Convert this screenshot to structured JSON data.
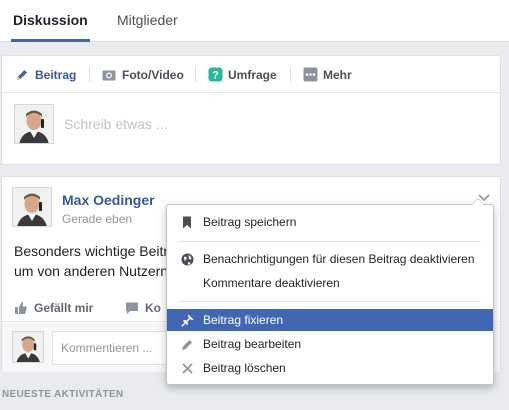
{
  "tabs": [
    {
      "label": "Diskussion",
      "active": true
    },
    {
      "label": "Mitglieder",
      "active": false
    }
  ],
  "composer": {
    "actions": [
      {
        "label": "Beitrag",
        "icon": "pencil-icon"
      },
      {
        "label": "Foto/Video",
        "icon": "camera-icon"
      },
      {
        "label": "Umfrage",
        "icon": "poll-icon"
      },
      {
        "label": "Mehr",
        "icon": "more-icon"
      }
    ],
    "placeholder": "Schreib etwas ..."
  },
  "post": {
    "author": "Max Oedinger",
    "time": "Gerade eben",
    "text_line1": "Besonders wichtige Beitr",
    "text_line2": "um von anderen Nutzern",
    "actions": {
      "like": "Gefällt mir",
      "comment": "Ko"
    },
    "comment_placeholder": "Kommentieren ..."
  },
  "menu": {
    "items": [
      {
        "label": "Beitrag speichern",
        "icon": "bookmark-icon"
      },
      {
        "label": "Benachrichtigungen für diesen Beitrag deaktivieren",
        "icon": "globe-icon"
      },
      {
        "label": "Kommentare deaktivieren",
        "icon": ""
      },
      {
        "label": "Beitrag fixieren",
        "icon": "pin-icon",
        "highlighted": true
      },
      {
        "label": "Beitrag bearbeiten",
        "icon": "pencil-icon"
      },
      {
        "label": "Beitrag löschen",
        "icon": "close-icon"
      }
    ]
  },
  "sections": {
    "recent_activity": "NEUESTE AKTIVITÄTEN"
  },
  "colors": {
    "accent": "#4267b2",
    "link": "#365899",
    "background": "#e9ebee"
  }
}
